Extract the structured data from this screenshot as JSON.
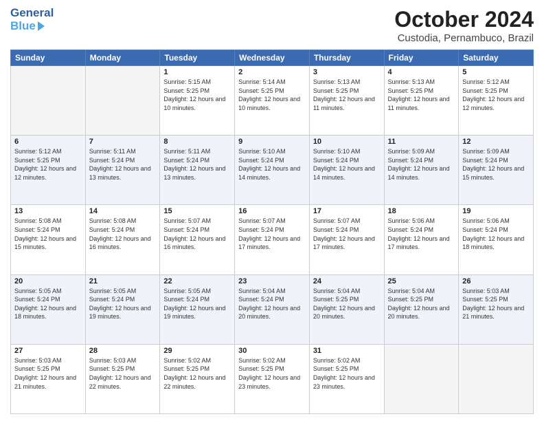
{
  "header": {
    "logo_general": "General",
    "logo_blue": "Blue",
    "month_title": "October 2024",
    "location": "Custodia, Pernambuco, Brazil"
  },
  "days_of_week": [
    "Sunday",
    "Monday",
    "Tuesday",
    "Wednesday",
    "Thursday",
    "Friday",
    "Saturday"
  ],
  "weeks": [
    [
      {
        "day": "",
        "sunrise": "",
        "sunset": "",
        "daylight": ""
      },
      {
        "day": "",
        "sunrise": "",
        "sunset": "",
        "daylight": ""
      },
      {
        "day": "1",
        "sunrise": "Sunrise: 5:15 AM",
        "sunset": "Sunset: 5:25 PM",
        "daylight": "Daylight: 12 hours and 10 minutes."
      },
      {
        "day": "2",
        "sunrise": "Sunrise: 5:14 AM",
        "sunset": "Sunset: 5:25 PM",
        "daylight": "Daylight: 12 hours and 10 minutes."
      },
      {
        "day": "3",
        "sunrise": "Sunrise: 5:13 AM",
        "sunset": "Sunset: 5:25 PM",
        "daylight": "Daylight: 12 hours and 11 minutes."
      },
      {
        "day": "4",
        "sunrise": "Sunrise: 5:13 AM",
        "sunset": "Sunset: 5:25 PM",
        "daylight": "Daylight: 12 hours and 11 minutes."
      },
      {
        "day": "5",
        "sunrise": "Sunrise: 5:12 AM",
        "sunset": "Sunset: 5:25 PM",
        "daylight": "Daylight: 12 hours and 12 minutes."
      }
    ],
    [
      {
        "day": "6",
        "sunrise": "Sunrise: 5:12 AM",
        "sunset": "Sunset: 5:25 PM",
        "daylight": "Daylight: 12 hours and 12 minutes."
      },
      {
        "day": "7",
        "sunrise": "Sunrise: 5:11 AM",
        "sunset": "Sunset: 5:24 PM",
        "daylight": "Daylight: 12 hours and 13 minutes."
      },
      {
        "day": "8",
        "sunrise": "Sunrise: 5:11 AM",
        "sunset": "Sunset: 5:24 PM",
        "daylight": "Daylight: 12 hours and 13 minutes."
      },
      {
        "day": "9",
        "sunrise": "Sunrise: 5:10 AM",
        "sunset": "Sunset: 5:24 PM",
        "daylight": "Daylight: 12 hours and 14 minutes."
      },
      {
        "day": "10",
        "sunrise": "Sunrise: 5:10 AM",
        "sunset": "Sunset: 5:24 PM",
        "daylight": "Daylight: 12 hours and 14 minutes."
      },
      {
        "day": "11",
        "sunrise": "Sunrise: 5:09 AM",
        "sunset": "Sunset: 5:24 PM",
        "daylight": "Daylight: 12 hours and 14 minutes."
      },
      {
        "day": "12",
        "sunrise": "Sunrise: 5:09 AM",
        "sunset": "Sunset: 5:24 PM",
        "daylight": "Daylight: 12 hours and 15 minutes."
      }
    ],
    [
      {
        "day": "13",
        "sunrise": "Sunrise: 5:08 AM",
        "sunset": "Sunset: 5:24 PM",
        "daylight": "Daylight: 12 hours and 15 minutes."
      },
      {
        "day": "14",
        "sunrise": "Sunrise: 5:08 AM",
        "sunset": "Sunset: 5:24 PM",
        "daylight": "Daylight: 12 hours and 16 minutes."
      },
      {
        "day": "15",
        "sunrise": "Sunrise: 5:07 AM",
        "sunset": "Sunset: 5:24 PM",
        "daylight": "Daylight: 12 hours and 16 minutes."
      },
      {
        "day": "16",
        "sunrise": "Sunrise: 5:07 AM",
        "sunset": "Sunset: 5:24 PM",
        "daylight": "Daylight: 12 hours and 17 minutes."
      },
      {
        "day": "17",
        "sunrise": "Sunrise: 5:07 AM",
        "sunset": "Sunset: 5:24 PM",
        "daylight": "Daylight: 12 hours and 17 minutes."
      },
      {
        "day": "18",
        "sunrise": "Sunrise: 5:06 AM",
        "sunset": "Sunset: 5:24 PM",
        "daylight": "Daylight: 12 hours and 17 minutes."
      },
      {
        "day": "19",
        "sunrise": "Sunrise: 5:06 AM",
        "sunset": "Sunset: 5:24 PM",
        "daylight": "Daylight: 12 hours and 18 minutes."
      }
    ],
    [
      {
        "day": "20",
        "sunrise": "Sunrise: 5:05 AM",
        "sunset": "Sunset: 5:24 PM",
        "daylight": "Daylight: 12 hours and 18 minutes."
      },
      {
        "day": "21",
        "sunrise": "Sunrise: 5:05 AM",
        "sunset": "Sunset: 5:24 PM",
        "daylight": "Daylight: 12 hours and 19 minutes."
      },
      {
        "day": "22",
        "sunrise": "Sunrise: 5:05 AM",
        "sunset": "Sunset: 5:24 PM",
        "daylight": "Daylight: 12 hours and 19 minutes."
      },
      {
        "day": "23",
        "sunrise": "Sunrise: 5:04 AM",
        "sunset": "Sunset: 5:24 PM",
        "daylight": "Daylight: 12 hours and 20 minutes."
      },
      {
        "day": "24",
        "sunrise": "Sunrise: 5:04 AM",
        "sunset": "Sunset: 5:25 PM",
        "daylight": "Daylight: 12 hours and 20 minutes."
      },
      {
        "day": "25",
        "sunrise": "Sunrise: 5:04 AM",
        "sunset": "Sunset: 5:25 PM",
        "daylight": "Daylight: 12 hours and 20 minutes."
      },
      {
        "day": "26",
        "sunrise": "Sunrise: 5:03 AM",
        "sunset": "Sunset: 5:25 PM",
        "daylight": "Daylight: 12 hours and 21 minutes."
      }
    ],
    [
      {
        "day": "27",
        "sunrise": "Sunrise: 5:03 AM",
        "sunset": "Sunset: 5:25 PM",
        "daylight": "Daylight: 12 hours and 21 minutes."
      },
      {
        "day": "28",
        "sunrise": "Sunrise: 5:03 AM",
        "sunset": "Sunset: 5:25 PM",
        "daylight": "Daylight: 12 hours and 22 minutes."
      },
      {
        "day": "29",
        "sunrise": "Sunrise: 5:02 AM",
        "sunset": "Sunset: 5:25 PM",
        "daylight": "Daylight: 12 hours and 22 minutes."
      },
      {
        "day": "30",
        "sunrise": "Sunrise: 5:02 AM",
        "sunset": "Sunset: 5:25 PM",
        "daylight": "Daylight: 12 hours and 23 minutes."
      },
      {
        "day": "31",
        "sunrise": "Sunrise: 5:02 AM",
        "sunset": "Sunset: 5:25 PM",
        "daylight": "Daylight: 12 hours and 23 minutes."
      },
      {
        "day": "",
        "sunrise": "",
        "sunset": "",
        "daylight": ""
      },
      {
        "day": "",
        "sunrise": "",
        "sunset": "",
        "daylight": ""
      }
    ]
  ]
}
